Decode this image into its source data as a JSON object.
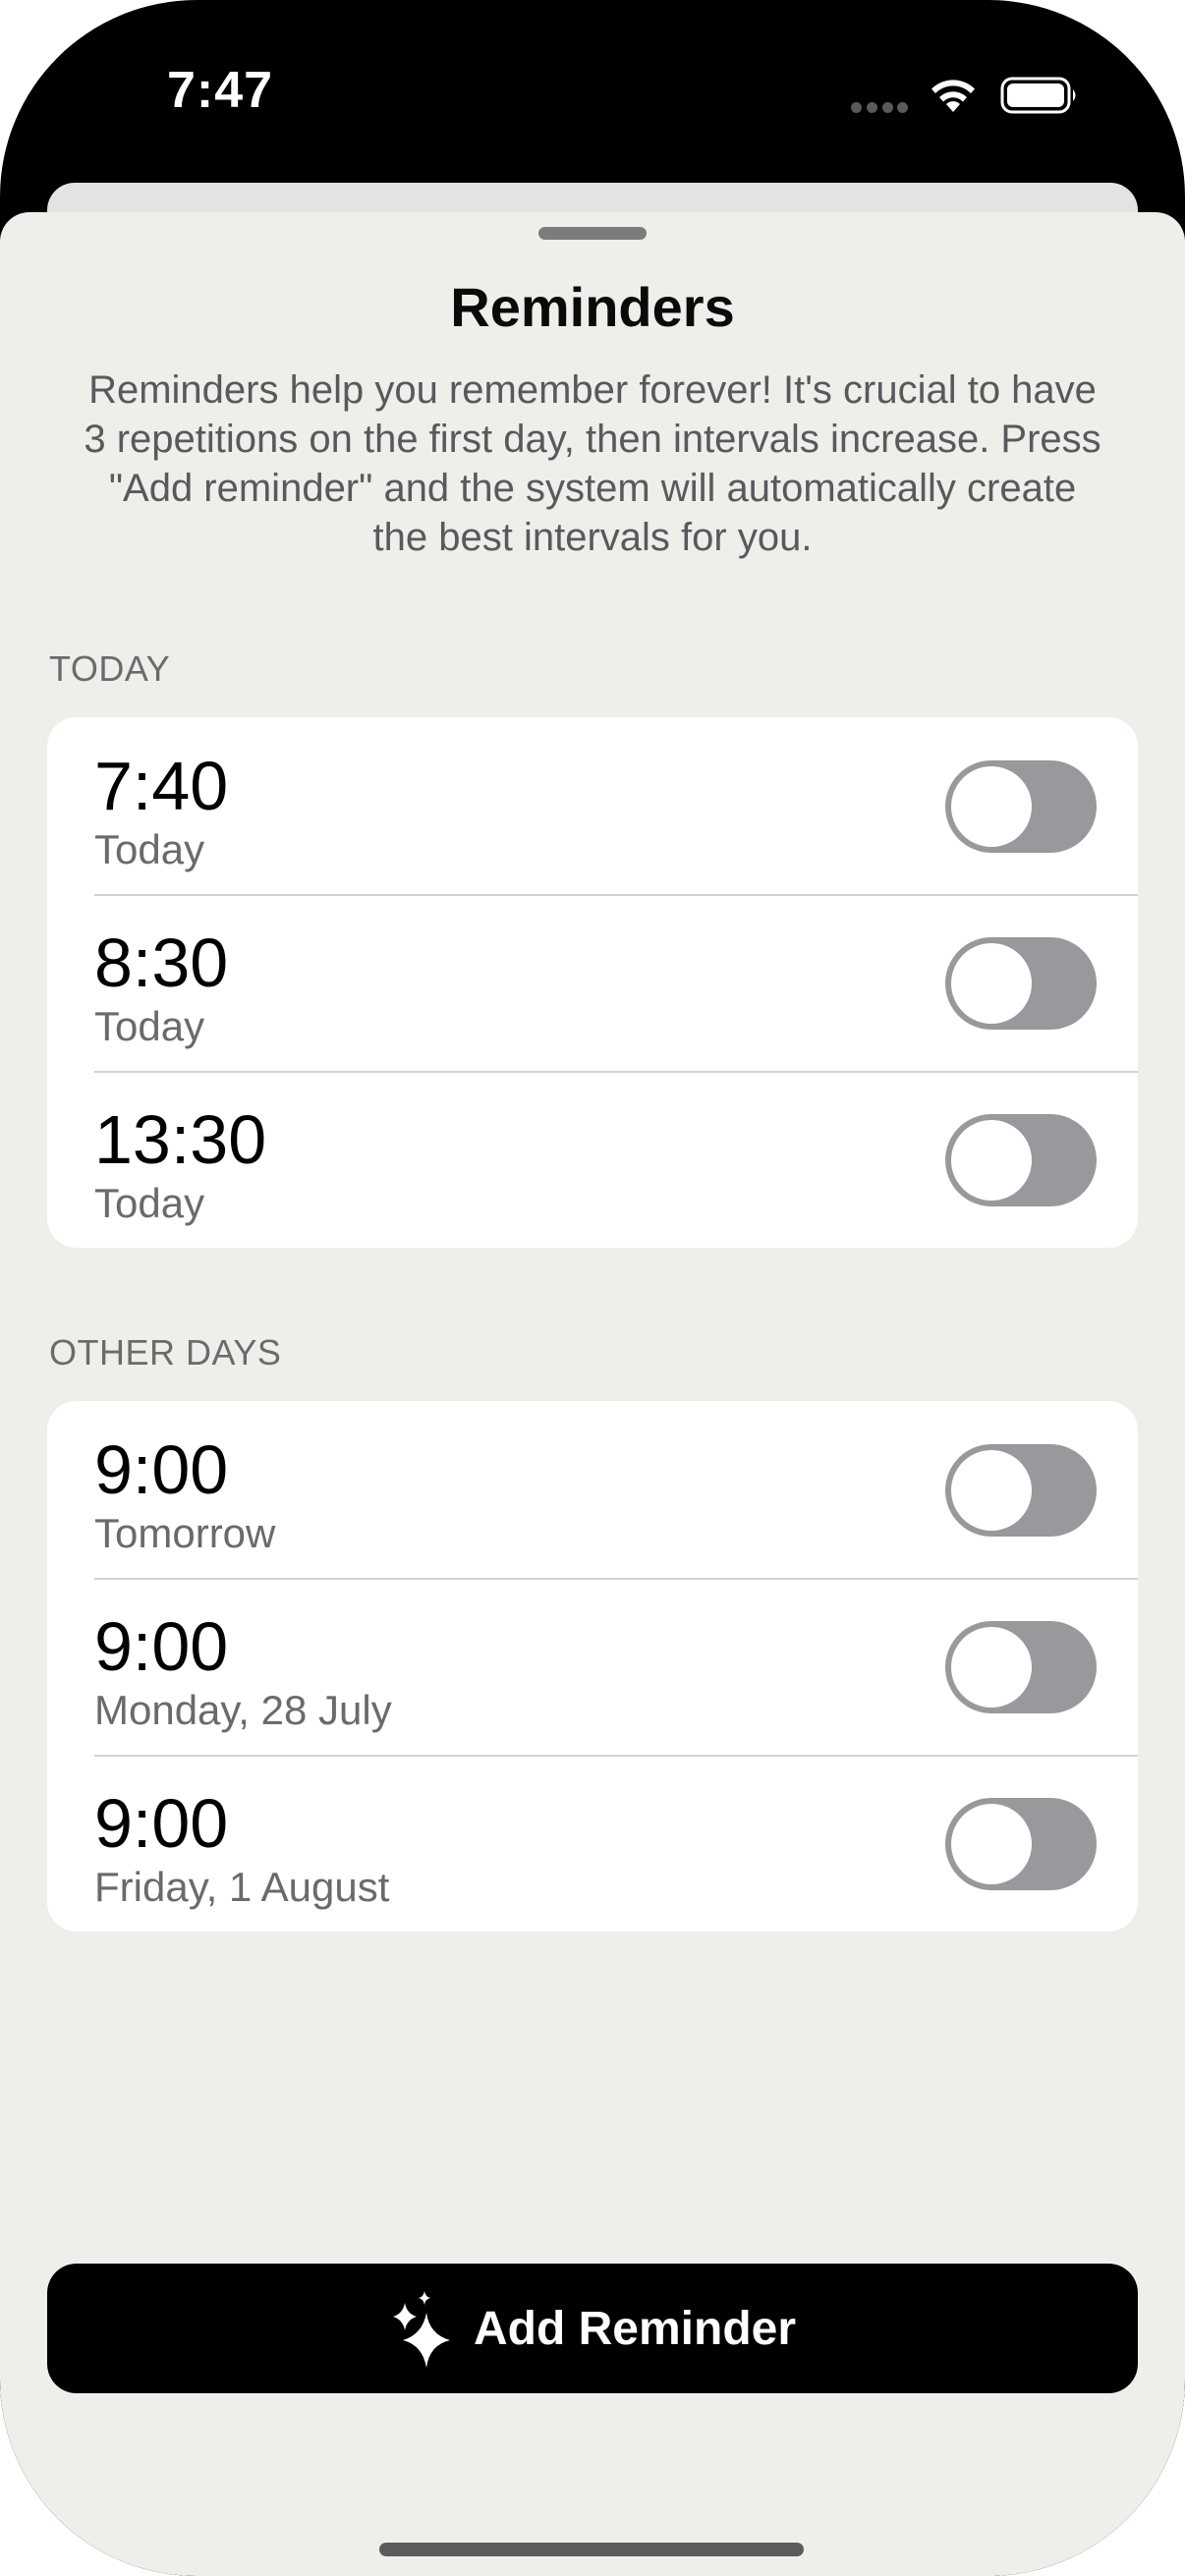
{
  "status_bar": {
    "time": "7:47",
    "icons": [
      "cellular-dots-icon",
      "wifi-icon",
      "battery-icon"
    ]
  },
  "sheet": {
    "title": "Reminders",
    "description": "Reminders help you remember forever! It's crucial to have 3 repetitions on the first day, then intervals increase. Press \"Add reminder\" and the system will automatically create the best intervals for you."
  },
  "sections": [
    {
      "header": "TODAY",
      "rows": [
        {
          "time": "7:40",
          "label": "Today",
          "enabled": false
        },
        {
          "time": "8:30",
          "label": "Today",
          "enabled": false
        },
        {
          "time": "13:30",
          "label": "Today",
          "enabled": false
        }
      ]
    },
    {
      "header": "OTHER DAYS",
      "rows": [
        {
          "time": "9:00",
          "label": "Tomorrow",
          "enabled": false
        },
        {
          "time": "9:00",
          "label": "Monday, 28 July",
          "enabled": false
        },
        {
          "time": "9:00",
          "label": "Friday, 1 August",
          "enabled": false
        }
      ]
    }
  ],
  "add_button": {
    "label": "Add Reminder",
    "icon": "sparkle-icon"
  },
  "colors": {
    "sheet_background": "#efeeeb",
    "card_background": "#ffffff",
    "toggle_off": "#98989d",
    "button_background": "#000000"
  }
}
